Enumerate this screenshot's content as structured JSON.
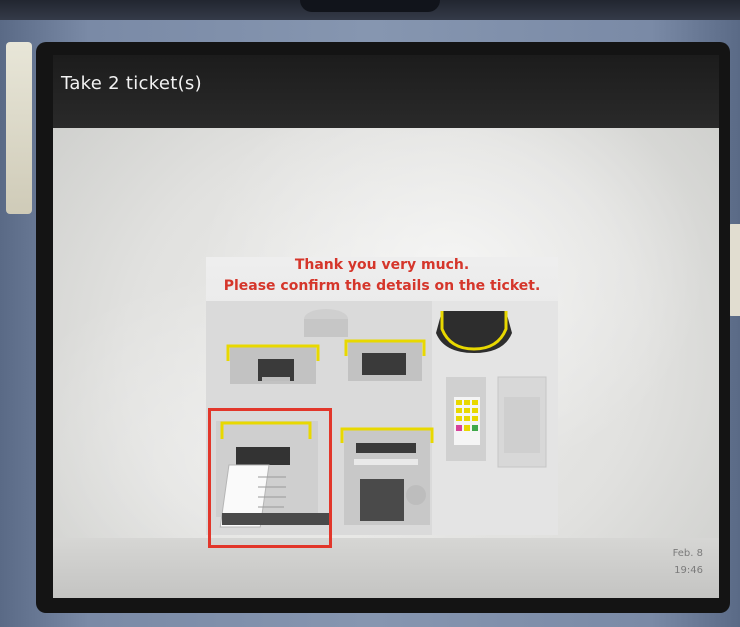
{
  "screen": {
    "title": "Take 2 ticket(s)"
  },
  "illustration": {
    "message_line1": "Thank you very much.",
    "message_line2": "Please confirm the details on the ticket."
  },
  "footer": {
    "date": "Feb. 8",
    "time": "19:46"
  },
  "colors": {
    "message": "#d5362b",
    "highlight": "#e2362a",
    "indicator": "#e8d800"
  }
}
